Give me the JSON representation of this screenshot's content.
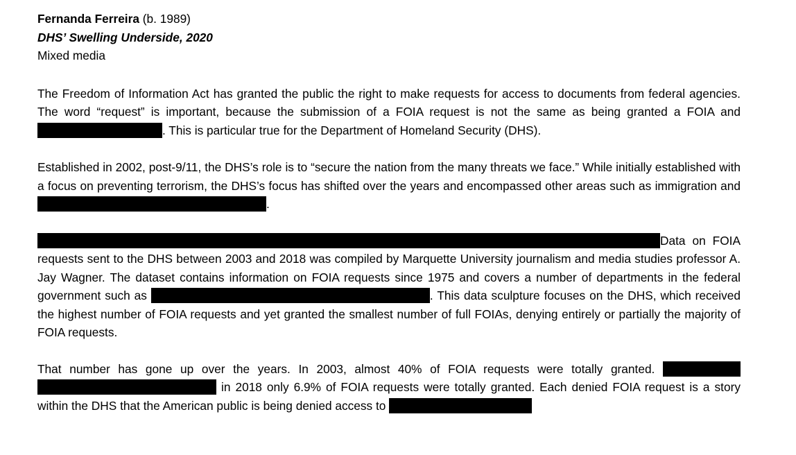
{
  "header": {
    "artist": "Fernanda Ferreira",
    "birth": "(b. 1989)",
    "title": "DHS’ Swelling Underside, 2020",
    "medium": "Mixed media"
  },
  "paragraphs": {
    "p1": {
      "a": "The Freedom of Information Act has granted the public the right to make requests for access to documents from federal agencies. The word “request” is important, because the submission of a FOIA request is not the same as being granted a FOIA and",
      "b": ". This is particular true for the Department of Homeland Security (DHS)."
    },
    "p2": {
      "a": "Established in 2002, post-9/11, the DHS’s role is to “secure the nation from the many threats we face.” While initially established with a focus on preventing terrorism, the DHS’s focus has shifted over the years and encompassed other areas such as immigration and",
      "b": "."
    },
    "p3": {
      "a": "Data on FOIA requests sent to the DHS between 2003 and 2018 was compiled by Marquette University journalism and media studies professor A. Jay Wagner.  The dataset contains information on FOIA requests since 1975 and covers a number of departments in the federal government such as",
      "b": ". This data sculpture focuses on the DHS, which received the highest number of FOIA requests and yet granted the smallest number of full FOIAs, denying entirely or partially the majority of FOIA requests."
    },
    "p4": {
      "a": "That number has gone up over the years. In 2003, almost 40% of FOIA requests were totally granted.",
      "b": "in 2018 only 6.9% of FOIA requests were totally granted. Each denied FOIA request is a story within the DHS that the American public is being denied access to"
    }
  }
}
